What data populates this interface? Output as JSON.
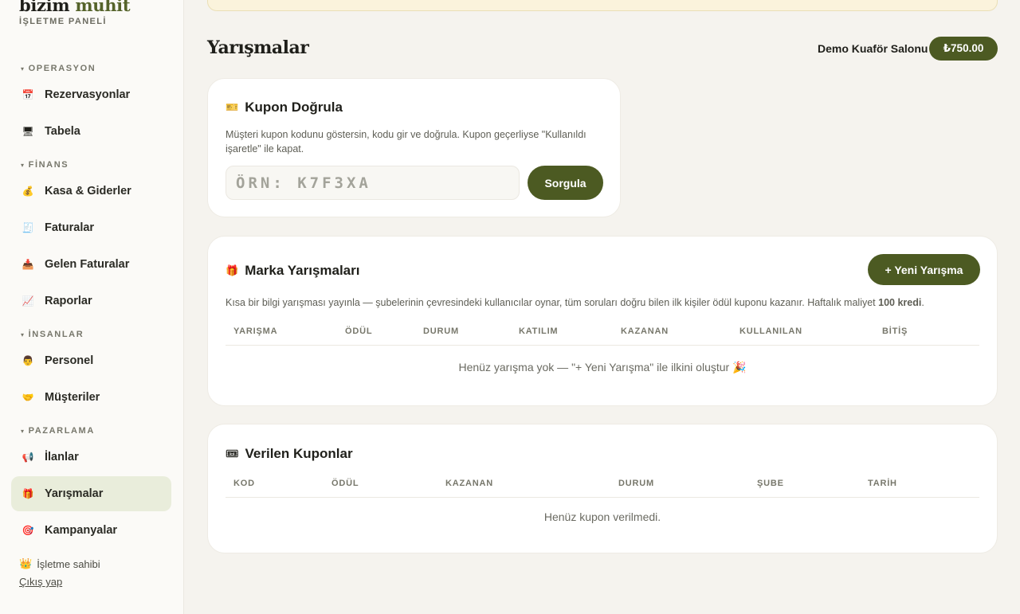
{
  "brand": {
    "name_part1": "bizim",
    "name_part2": "muhit",
    "subtitle": "İŞLETME PANELİ"
  },
  "sidebar": {
    "sections": [
      {
        "label": "OPERASYON"
      },
      {
        "label": "FİNANS"
      },
      {
        "label": "İNSANLAR"
      },
      {
        "label": "PAZARLAMA"
      }
    ],
    "items": [
      {
        "label": "Rezervasyonlar",
        "icon": "📅"
      },
      {
        "label": "Tabela",
        "icon": "🖥"
      },
      {
        "label": "Kasa & Giderler",
        "icon": "💰"
      },
      {
        "label": "Faturalar",
        "icon": "🧾"
      },
      {
        "label": "Gelen Faturalar",
        "icon": "📥"
      },
      {
        "label": "Raporlar",
        "icon": "📈"
      },
      {
        "label": "Personel",
        "icon": "👨"
      },
      {
        "label": "Müşteriler",
        "icon": "🤝"
      },
      {
        "label": "İlanlar",
        "icon": "📢"
      },
      {
        "label": "Yarışmalar",
        "icon": "🎁"
      },
      {
        "label": "Kampanyalar",
        "icon": "🎯"
      }
    ],
    "owner_label": "İşletme sahibi",
    "owner_icon": "👑",
    "logout_label": "Çıkış yap"
  },
  "header": {
    "title": "Yarışmalar",
    "salon_name": "Demo Kuaför Salonu",
    "balance": "₺750.00"
  },
  "coupon_verify": {
    "icon": "🎫",
    "title": "Kupon Doğrula",
    "description": "Müşteri kupon kodunu göstersin, kodu gir ve doğrula. Kupon geçerliyse \"Kullanıldı işaretle\" ile kapat.",
    "input_placeholder": "ÖRN: K7F3XA",
    "button_label": "Sorgula"
  },
  "contests": {
    "icon": "🎁",
    "title": "Marka Yarışmaları",
    "new_button_label": "+ Yeni Yarışma",
    "description_prefix": "Kısa bir bilgi yarışması yayınla — şubelerinin çevresindeki kullanıcılar oynar, tüm soruları doğru bilen ilk kişiler ödül kuponu kazanır. Haftalık maliyet ",
    "description_bold": "100 kredi",
    "description_suffix": ".",
    "columns": [
      "YARIŞMA",
      "ÖDÜL",
      "DURUM",
      "KATILIM",
      "KAZANAN",
      "KULLANILAN",
      "BİTİŞ"
    ],
    "empty_text": "Henüz yarışma yok — \"+ Yeni Yarışma\" ile ilkini oluştur 🎉"
  },
  "issued_coupons": {
    "icon": "🎟",
    "title": "Verilen Kuponlar",
    "columns": [
      "KOD",
      "ÖDÜL",
      "KAZANAN",
      "DURUM",
      "ŞUBE",
      "TARİH"
    ],
    "empty_text": "Henüz kupon verilmedi."
  },
  "colors": {
    "accent": "#4c5a22",
    "active_bg": "#e9eddb",
    "page_bg": "#f5f3ee"
  }
}
